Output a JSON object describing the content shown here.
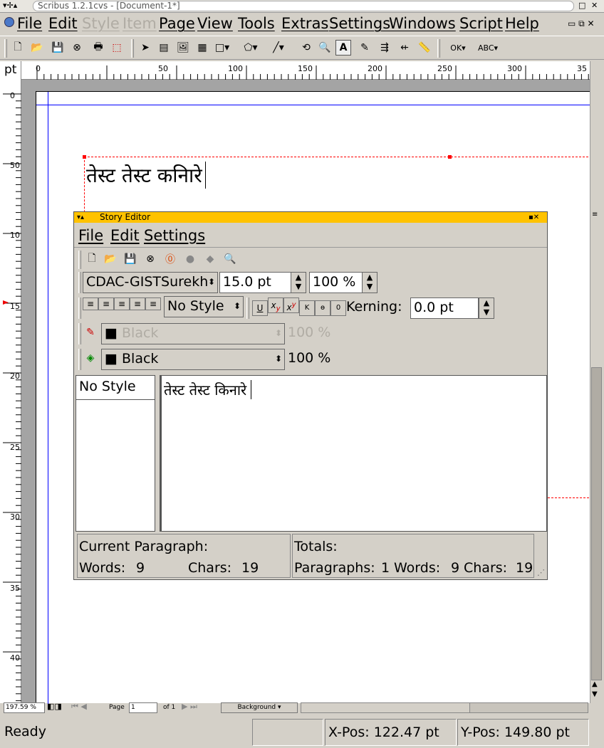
{
  "window": {
    "title": "Scribus 1.2.1cvs - [Document-1*]"
  },
  "menubar": {
    "items": [
      "File",
      "Edit",
      "Style",
      "Item",
      "Page",
      "View",
      "Tools",
      "Extras",
      "Settings",
      "Windows",
      "Script",
      "Help"
    ]
  },
  "ruler": {
    "unit": "pt",
    "h_ticks": [
      "0",
      "50",
      "100",
      "150",
      "200",
      "250",
      "300",
      "35"
    ],
    "v_ticks": [
      "0",
      "50",
      "10",
      "15",
      "20",
      "25",
      "30",
      "35",
      "40"
    ]
  },
  "document": {
    "text": "तेस्ट तेस्ट कनिारे"
  },
  "story_editor": {
    "title": "Story Editor",
    "menu": [
      "File",
      "Edit",
      "Settings"
    ],
    "font": "CDAC-GISTSurekh",
    "font_size": "15.0 pt",
    "scale": "100 %",
    "style": "No Style",
    "kerning_label": "Kerning:",
    "kerning": "0.0 pt",
    "stroke_color": "Black",
    "stroke_shade": "100 %",
    "fill_color": "Black",
    "fill_shade": "100 %",
    "style_list_item": "No Style",
    "text": "तेस्ट तेस्ट किनारे",
    "current_paragraph": {
      "label": "Current Paragraph:",
      "words_label": "Words:",
      "words": "9",
      "chars_label": "Chars:",
      "chars": "19"
    },
    "totals": {
      "label": "Totals:",
      "paragraphs_label": "Paragraphs:",
      "paragraphs": "1",
      "words_label": "Words:",
      "words": "9",
      "chars_label": "Chars:",
      "chars": "19"
    }
  },
  "bottombar": {
    "zoom": "197.59 %",
    "page_label": "Page",
    "page_value": "1",
    "of_label": "of 1",
    "layer": "Background"
  },
  "status": {
    "text": "Ready",
    "xpos_label": "X-Pos:",
    "xpos": "122.47 pt",
    "ypos_label": "Y-Pos:",
    "ypos": "149.80 pt"
  },
  "colors": {
    "story_title": "#ffc200",
    "guide": "#0000ff",
    "frame": "#ff0000"
  }
}
